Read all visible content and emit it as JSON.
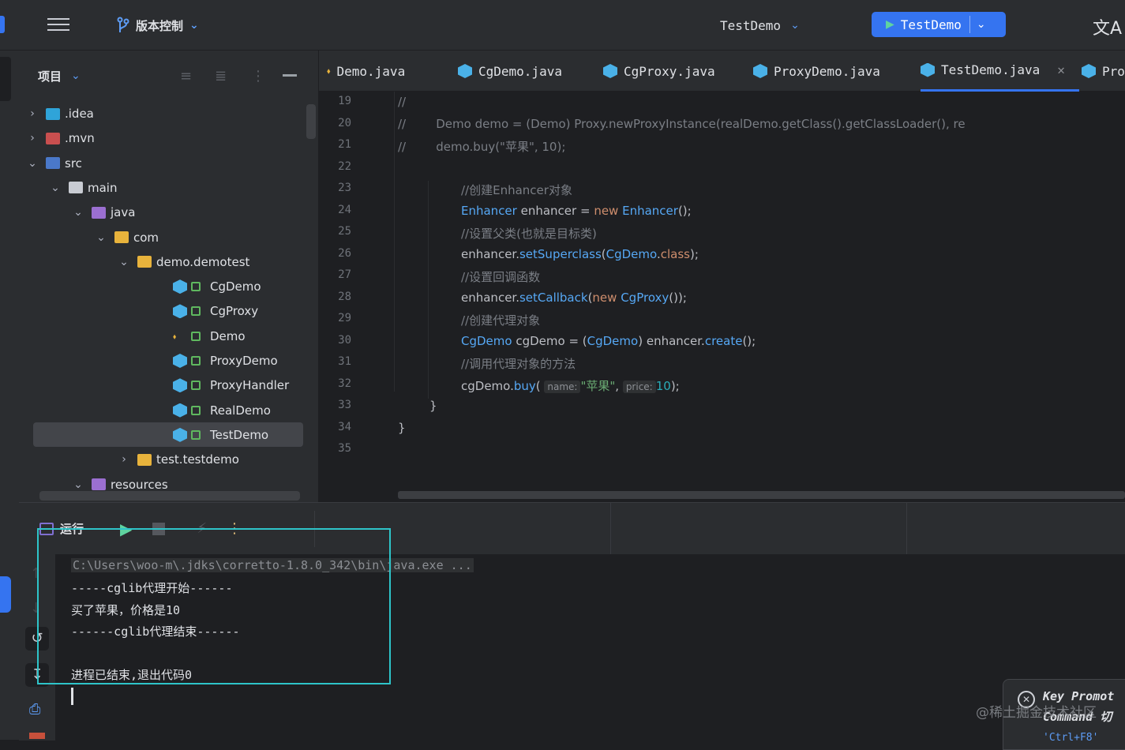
{
  "titlebar": {
    "vcs_label": "版本控制",
    "project_name": "TestDemo",
    "run_config": "TestDemo",
    "translate_glyph": "文A"
  },
  "project_panel": {
    "title": "项目",
    "tree": [
      {
        "label": ".idea",
        "level": 0,
        "expanded": false,
        "kind": "folder-idea"
      },
      {
        "label": ".mvn",
        "level": 0,
        "expanded": false,
        "kind": "folder-mvn"
      },
      {
        "label": "src",
        "level": 0,
        "expanded": true,
        "kind": "folder-src"
      },
      {
        "label": "main",
        "level": 1,
        "expanded": true,
        "kind": "folder"
      },
      {
        "label": "java",
        "level": 2,
        "expanded": true,
        "kind": "folder-java"
      },
      {
        "label": "com",
        "level": 3,
        "expanded": true,
        "kind": "package"
      },
      {
        "label": "demo.demotest",
        "level": 4,
        "expanded": true,
        "kind": "package"
      },
      {
        "label": "CgDemo",
        "level": 5,
        "kind": "class"
      },
      {
        "label": "CgProxy",
        "level": 5,
        "kind": "class"
      },
      {
        "label": "Demo",
        "level": 5,
        "kind": "interface"
      },
      {
        "label": "ProxyDemo",
        "level": 5,
        "kind": "class"
      },
      {
        "label": "ProxyHandler",
        "level": 5,
        "kind": "class"
      },
      {
        "label": "RealDemo",
        "level": 5,
        "kind": "class"
      },
      {
        "label": "TestDemo",
        "level": 5,
        "kind": "class-main",
        "selected": true
      },
      {
        "label": "test.testdemo",
        "level": 4,
        "expanded": false,
        "kind": "package"
      },
      {
        "label": "resources",
        "level": 2,
        "expanded": true,
        "kind": "folder-res"
      }
    ]
  },
  "editor": {
    "tabs": [
      {
        "label": "Demo.java",
        "icon": "interface-icon"
      },
      {
        "label": "CgDemo.java",
        "icon": "class-icon"
      },
      {
        "label": "CgProxy.java",
        "icon": "class-icon"
      },
      {
        "label": "ProxyDemo.java",
        "icon": "class-icon"
      },
      {
        "label": "TestDemo.java",
        "icon": "class-icon",
        "active": true
      },
      {
        "label": "Pro",
        "icon": "class-icon"
      }
    ],
    "line_numbers": [
      "19",
      "20",
      "21",
      "22",
      "23",
      "24",
      "25",
      "26",
      "27",
      "28",
      "29",
      "30",
      "31",
      "32",
      "33",
      "34",
      "35"
    ],
    "lines": {
      "l19": "//",
      "l20a": "//",
      "l20b": "        Demo demo = (Demo) Proxy.newProxyInstance(realDemo.getClass().getClassLoader(), re",
      "l21a": "//",
      "l21b": "        demo.buy(\"苹果\", 10);",
      "l23": "//创建Enhancer对象",
      "l24_type": "Enhancer",
      "l24_var": " enhancer = ",
      "l24_new": "new",
      "l24_ctor": " Enhancer",
      "l24_end": "();",
      "l25": "//设置父类(也就是目标类)",
      "l26_a": "enhancer.",
      "l26_fn": "setSuperclass",
      "l26_b": "(",
      "l26_cls": "CgDemo",
      "l26_c": ".",
      "l26_kw": "class",
      "l26_d": ");",
      "l27": "//设置回调函数",
      "l28_a": "enhancer.",
      "l28_fn": "setCallback",
      "l28_b": "(",
      "l28_kw": "new",
      "l28_cls": " CgProxy",
      "l28_c": "());",
      "l29": "//创建代理对象",
      "l30_type": "CgDemo",
      "l30_a": " cgDemo = (",
      "l30_cls": "CgDemo",
      "l30_b": ") enhancer.",
      "l30_fn": "create",
      "l30_c": "();",
      "l31": "//调用代理对象的方法",
      "l32_a": "cgDemo.",
      "l32_fn": "buy",
      "l32_b": "( ",
      "l32_hint1": "name:",
      "l32_str": "\"苹果\"",
      "l32_c": ", ",
      "l32_hint2": "price:",
      "l32_num": "10",
      "l32_d": ");",
      "l33": "}",
      "l34": "}"
    }
  },
  "run_panel": {
    "title": "运行",
    "output": [
      "C:\\Users\\woo-m\\.jdks\\corretto-1.8.0_342\\bin\\java.exe ...",
      "-----cglib代理开始------",
      "买了苹果，价格是10",
      "------cglib代理结束------",
      "",
      "进程已结束,退出代码0"
    ]
  },
  "toast": {
    "title": "Key Promot",
    "subtitle": "Command 切",
    "hint": "'Ctrl+F8'"
  },
  "watermark": "@稀土掘金技术社区",
  "colors": {
    "accent": "#3574f0",
    "highlight_box": "#2ec4c9",
    "class_icon": "#4ab1e8",
    "folder": "#e8b33c"
  }
}
